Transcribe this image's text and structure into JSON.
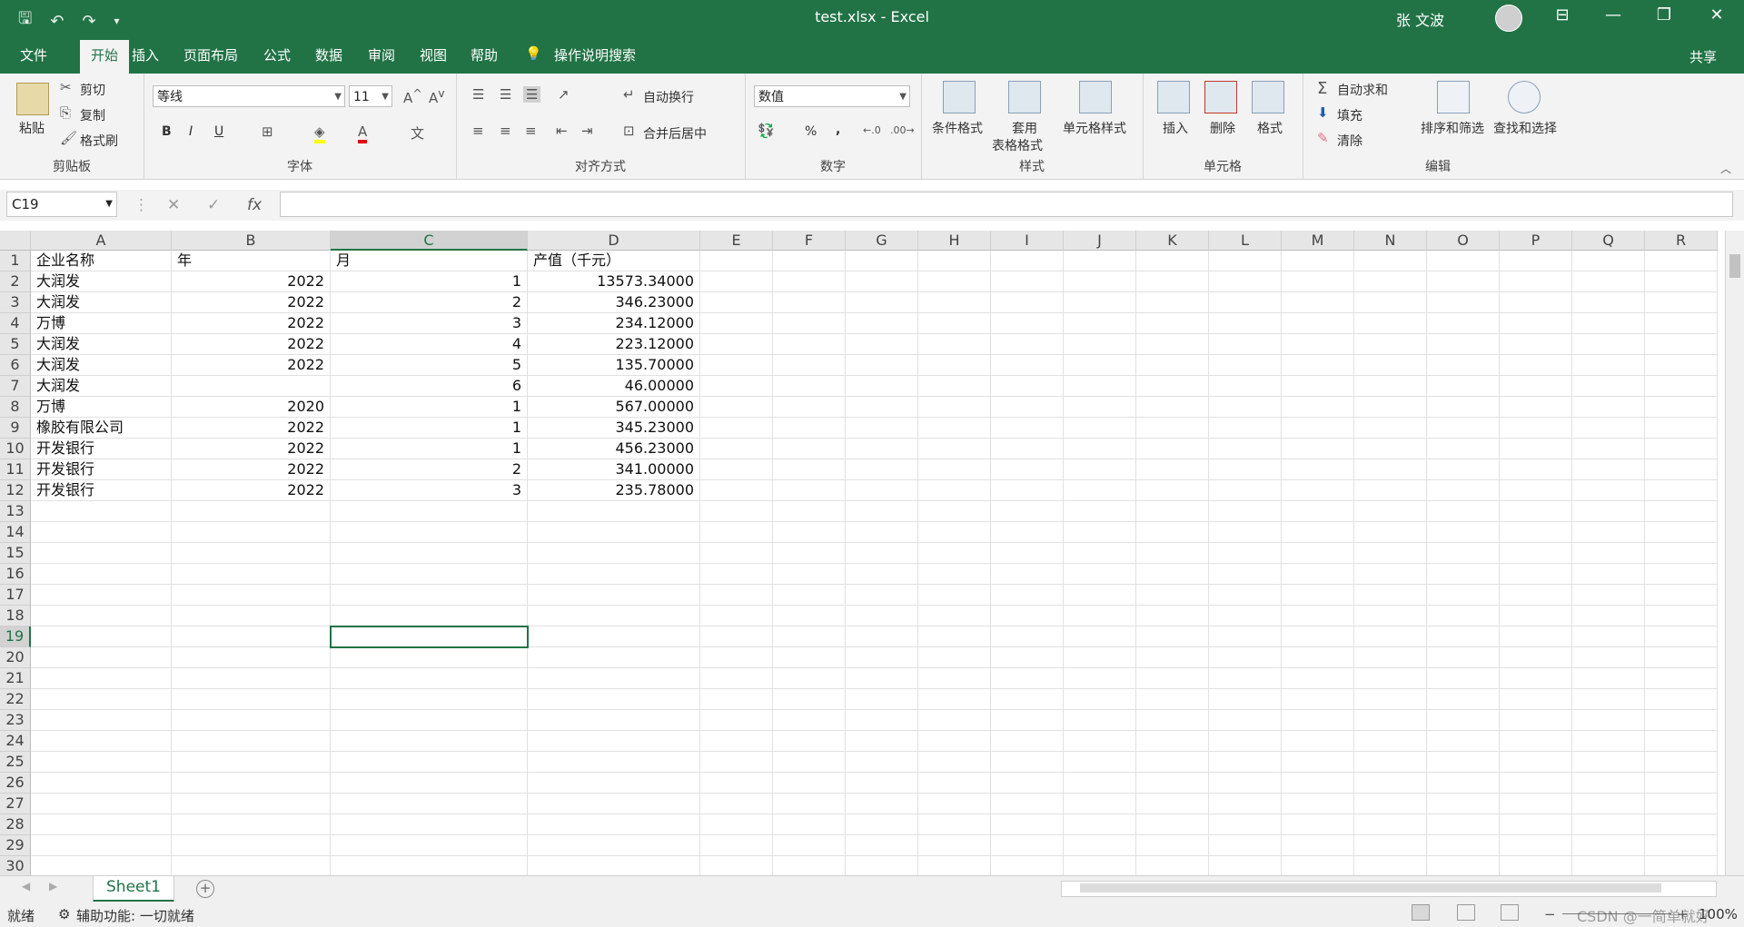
{
  "app": {
    "file_title": "test.xlsx  -  Excel",
    "user_name": "张 文波"
  },
  "quick_access": {
    "save_icon": "save-icon",
    "undo_icon": "undo-icon",
    "redo_icon": "redo-icon"
  },
  "tabs": [
    "文件",
    "开始",
    "插入",
    "页面布局",
    "公式",
    "数据",
    "审阅",
    "视图",
    "帮助"
  ],
  "active_tab": "开始",
  "tell_me": "操作说明搜索",
  "share_label": "共享",
  "ribbon": {
    "clipboard": {
      "paste": "粘贴",
      "cut": "剪切",
      "copy": "复制",
      "format_painter": "格式刷",
      "group": "剪贴板"
    },
    "font": {
      "font_name": "等线",
      "font_size": "11",
      "bold": "B",
      "italic": "I",
      "underline": "U",
      "group": "字体"
    },
    "alignment": {
      "wrap": "自动换行",
      "merge": "合并后居中",
      "group": "对齐方式"
    },
    "number": {
      "format": "数值",
      "percent": "%",
      "comma": ",",
      "group": "数字"
    },
    "styles": {
      "conditional": "条件格式",
      "table_format_1": "套用",
      "table_format_2": "表格格式",
      "cell_styles": "单元格样式",
      "group": "样式"
    },
    "cells": {
      "insert": "插入",
      "delete": "删除",
      "format": "格式",
      "group": "单元格"
    },
    "editing": {
      "autosum": "自动求和",
      "fill": "填充",
      "clear": "清除",
      "sort": "排序和筛选",
      "find": "查找和选择",
      "group": "编辑"
    }
  },
  "formula_bar": {
    "name_box": "C19",
    "fx": "fx",
    "formula": ""
  },
  "columns": [
    "A",
    "B",
    "C",
    "D",
    "E",
    "F",
    "G",
    "H",
    "I",
    "J",
    "K",
    "L",
    "M",
    "N",
    "O",
    "P",
    "Q",
    "R"
  ],
  "selected_column": "C",
  "selected_row": 19,
  "rows": [
    [
      "企业名称",
      "年",
      "月",
      "产值（千元）"
    ],
    [
      "大润发",
      "2022",
      "1",
      "13573.34000"
    ],
    [
      "大润发",
      "2022",
      "2",
      "346.23000"
    ],
    [
      "万博",
      "2022",
      "3",
      "234.12000"
    ],
    [
      "大润发",
      "2022",
      "4",
      "223.12000"
    ],
    [
      "大润发",
      "2022",
      "5",
      "135.70000"
    ],
    [
      "大润发",
      "",
      "6",
      "46.00000"
    ],
    [
      "万博",
      "2020",
      "1",
      "567.00000"
    ],
    [
      "橡胶有限公司",
      "2022",
      "1",
      "345.23000"
    ],
    [
      "开发银行",
      "2022",
      "1",
      "456.23000"
    ],
    [
      "开发银行",
      "2022",
      "2",
      "341.00000"
    ],
    [
      "开发银行",
      "2022",
      "3",
      "235.78000"
    ]
  ],
  "sheet": {
    "name": "Sheet1"
  },
  "status": {
    "ready": "就绪",
    "accessibility": "辅助功能: 一切就绪",
    "zoom": "100%",
    "watermark": "CSDN @一简单就好"
  }
}
